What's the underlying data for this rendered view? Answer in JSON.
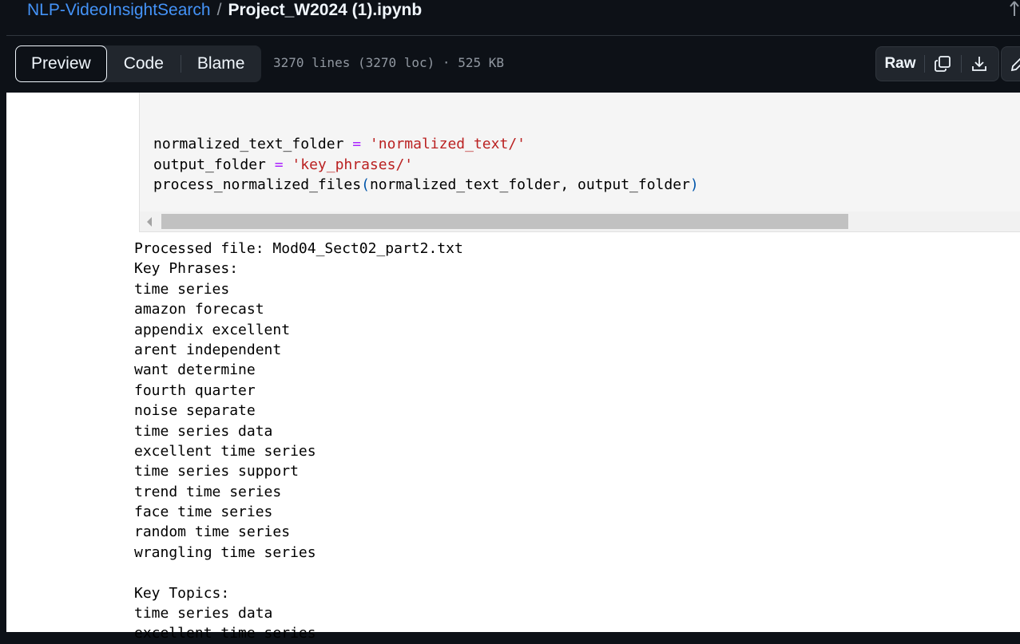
{
  "breadcrumb": {
    "repo": "NLP-VideoInsightSearch",
    "separator": "/",
    "file": "Project_W2024 (1).ipynb"
  },
  "view_tabs": [
    {
      "label": "Preview",
      "active": true
    },
    {
      "label": "Code",
      "active": false
    },
    {
      "label": "Blame",
      "active": false
    }
  ],
  "file_info": "3270 lines (3270 loc) · 525 KB",
  "actions": {
    "raw_label": "Raw",
    "copy_icon": "copy-icon",
    "download_icon": "download-icon",
    "edit_icon": "pencil-icon"
  },
  "code_cell": {
    "line1": {
      "var": "normalized_text_folder ",
      "op": "=",
      "str": " 'normalized_text/'"
    },
    "line2": {
      "var": "output_folder ",
      "op": "=",
      "str": " 'key_phrases/'"
    },
    "line3": {
      "func": "process_normalized_files",
      "open": "(",
      "args": "normalized_text_folder, output_folder",
      "close": ")"
    }
  },
  "output_lines": [
    "Processed file: Mod04_Sect02_part2.txt",
    "Key Phrases:",
    "time series",
    "amazon forecast",
    "appendix excellent",
    "arent independent",
    "want determine",
    "fourth quarter",
    "noise separate",
    "time series data",
    "excellent time series",
    "time series support",
    "trend time series",
    "face time series",
    "random time series",
    "wrangling time series",
    "",
    "Key Topics:",
    "time series data",
    "excellent time series"
  ],
  "colors": {
    "header_bg": "#0d1117",
    "link_blue": "#4493f8",
    "code_operator": "#aa22ff",
    "code_string": "#ba2121"
  }
}
